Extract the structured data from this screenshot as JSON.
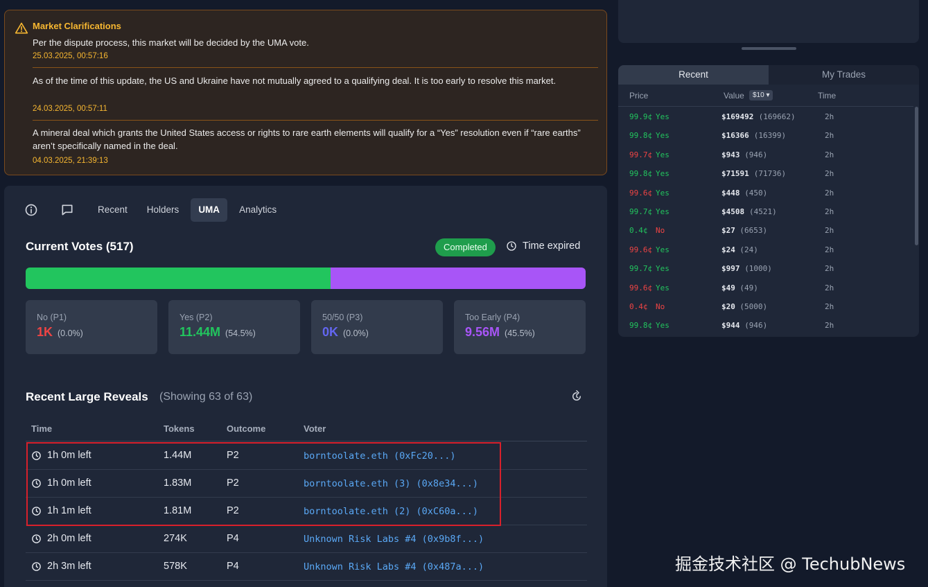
{
  "clarifications": {
    "title": "Market Clarifications",
    "items": [
      {
        "text": "Per the dispute process, this market will be decided by the UMA vote.",
        "timestamp": "25.03.2025, 00:57:16"
      },
      {
        "text": "As of the time of this update, the US and Ukraine have not mutually agreed to a qualifying deal. It is too early to resolve this market.",
        "timestamp": "24.03.2025, 00:57:11"
      },
      {
        "text": "A mineral deal which grants the United States access or rights to rare earth elements will qualify for a “Yes” resolution even if “rare earths” aren’t specifically named in the deal.",
        "timestamp": "04.03.2025, 21:39:13"
      }
    ]
  },
  "tabs": [
    {
      "label": "Recent"
    },
    {
      "label": "Holders"
    },
    {
      "label": "UMA",
      "active": true
    },
    {
      "label": "Analytics"
    }
  ],
  "votes": {
    "title": "Current Votes (517)",
    "status": "Completed",
    "expired": "Time expired",
    "distribution": [
      {
        "key": "no",
        "fraction": 0.0,
        "color": "#ef4444"
      },
      {
        "key": "yes",
        "fraction": 0.545,
        "color": "#22c55e"
      },
      {
        "key": "fifty",
        "fraction": 0.0,
        "color": "#6366f1"
      },
      {
        "key": "early",
        "fraction": 0.455,
        "color": "#a855f7"
      }
    ],
    "cards": [
      {
        "label": "No (P1)",
        "value": "1K",
        "pct": "(0.0%)",
        "color": "#ef4444"
      },
      {
        "label": "Yes (P2)",
        "value": "11.44M",
        "pct": "(54.5%)",
        "color": "#22c55e"
      },
      {
        "label": "50/50 (P3)",
        "value": "0K",
        "pct": "(0.0%)",
        "color": "#6366f1"
      },
      {
        "label": "Too Early (P4)",
        "value": "9.56M",
        "pct": "(45.5%)",
        "color": "#a855f7"
      }
    ]
  },
  "reveals": {
    "title": "Recent Large Reveals",
    "subtitle": "(Showing 63 of 63)",
    "headers": [
      "Time",
      "Tokens",
      "Outcome",
      "Voter"
    ],
    "rows": [
      {
        "time": "1h 0m left",
        "tokens": "1.44M",
        "outcome": "P2",
        "voter": "borntoolate.eth (0xFc20...)"
      },
      {
        "time": "1h 0m left",
        "tokens": "1.83M",
        "outcome": "P2",
        "voter": "borntoolate.eth (3) (0x8e34...)"
      },
      {
        "time": "1h 1m left",
        "tokens": "1.81M",
        "outcome": "P2",
        "voter": "borntoolate.eth (2) (0xC60a...)"
      },
      {
        "time": "2h 0m left",
        "tokens": "274K",
        "outcome": "P4",
        "voter": "Unknown Risk Labs #4 (0x9b8f...)"
      },
      {
        "time": "2h 3m left",
        "tokens": "578K",
        "outcome": "P4",
        "voter": "Unknown Risk Labs #4 (0x487a...)"
      }
    ]
  },
  "trades": {
    "tabs": [
      "Recent",
      "My Trades"
    ],
    "headers": {
      "price": "Price",
      "value": "Value",
      "value_chip": "$10 ▾",
      "time": "Time"
    },
    "rows": [
      {
        "price": "99.9¢",
        "side": "Yes",
        "value": "$169492",
        "shares": "(169662)",
        "time": "2h",
        "price_color": "#22c55e"
      },
      {
        "price": "99.8¢",
        "side": "Yes",
        "value": "$16366",
        "shares": "(16399)",
        "time": "2h",
        "price_color": "#22c55e"
      },
      {
        "price": "99.7¢",
        "side": "Yes",
        "value": "$943",
        "shares": "(946)",
        "time": "2h",
        "price_color": "#ef4444"
      },
      {
        "price": "99.8¢",
        "side": "Yes",
        "value": "$71591",
        "shares": "(71736)",
        "time": "2h",
        "price_color": "#22c55e"
      },
      {
        "price": "99.6¢",
        "side": "Yes",
        "value": "$448",
        "shares": "(450)",
        "time": "2h",
        "price_color": "#ef4444"
      },
      {
        "price": "99.7¢",
        "side": "Yes",
        "value": "$4508",
        "shares": "(4521)",
        "time": "2h",
        "price_color": "#22c55e"
      },
      {
        "price": "0.4¢",
        "side": "No",
        "value": "$27",
        "shares": "(6653)",
        "time": "2h",
        "price_color": "#22c55e"
      },
      {
        "price": "99.6¢",
        "side": "Yes",
        "value": "$24",
        "shares": "(24)",
        "time": "2h",
        "price_color": "#ef4444"
      },
      {
        "price": "99.7¢",
        "side": "Yes",
        "value": "$997",
        "shares": "(1000)",
        "time": "2h",
        "price_color": "#22c55e"
      },
      {
        "price": "99.6¢",
        "side": "Yes",
        "value": "$49",
        "shares": "(49)",
        "time": "2h",
        "price_color": "#ef4444"
      },
      {
        "price": "0.4¢",
        "side": "No",
        "value": "$20",
        "shares": "(5000)",
        "time": "2h",
        "price_color": "#ef4444"
      },
      {
        "price": "99.8¢",
        "side": "Yes",
        "value": "$944",
        "shares": "(946)",
        "time": "2h",
        "price_color": "#22c55e"
      }
    ]
  },
  "watermark": "掘金技术社区 @ TechubNews"
}
